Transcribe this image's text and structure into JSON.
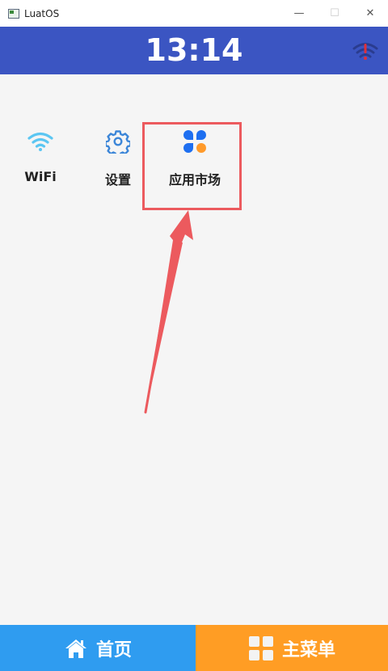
{
  "window": {
    "title": "LuatOS",
    "controls": {
      "minimize": "—",
      "maximize": "☐",
      "close": "✕"
    }
  },
  "header": {
    "time": "13:14",
    "status_icon": "wifi-warning-icon",
    "bg_color": "#3b55c2"
  },
  "apps": [
    {
      "label": "WiFi",
      "icon": "wifi-icon"
    },
    {
      "label": "设置",
      "icon": "gear-icon"
    },
    {
      "label": "应用市场",
      "icon": "app-store-icon"
    }
  ],
  "annotation": {
    "highlight_color": "#ec5a5e",
    "highlighted_app": "应用市场"
  },
  "nav": {
    "home_label": "首页",
    "home_icon": "home-icon",
    "home_color": "#2f9cf0",
    "menu_label": "主菜单",
    "menu_icon": "grid-icon",
    "menu_color": "#ff9d24"
  }
}
